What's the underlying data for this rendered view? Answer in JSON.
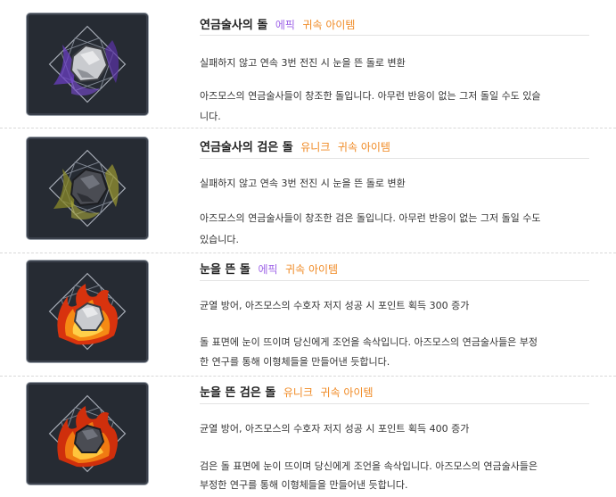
{
  "items": [
    {
      "name": "연금술사의 돌",
      "grade": "에픽",
      "grade_color": "#a066e8",
      "binding": "귀속 아이템",
      "binding_color": "#f08a24",
      "effect": "실패하지 않고 연속 3번 전진 시 눈을 뜬 돌로 변환",
      "desc_line1": "아즈모스의 연금술사들이 창조한 돌입니다. 아무런 반응이 없는 그저 돌일 수도 있슬",
      "desc_line2": "니다.",
      "icon": "grey-alchemist-stone-icon"
    },
    {
      "name": "연금술사의 검은 돌",
      "grade": "유니크",
      "grade_color": "#f08a24",
      "binding": "귀속 아이템",
      "binding_color": "#f08a24",
      "effect": "실패하지 않고 연속 3번 전진 시 눈을 뜬 돌로 변환",
      "desc_line1": "아즈모스의 연금술사들이 창조한 검은 돌입니다. 아무런 반응이 없는 그저 돌일 수도",
      "desc_line2": "있습니다.",
      "icon": "black-alchemist-stone-icon"
    },
    {
      "name": "눈을 뜬 돌",
      "grade": "에픽",
      "grade_color": "#a066e8",
      "binding": "귀속 아이템",
      "binding_color": "#f08a24",
      "effect": "균열 방어, 아즈모스의 수호자 저지 성공 시 포인트 획득 300 증가",
      "desc_line1": "돌 표면에 눈이 뜨이며 당신에게 조언을 속삭입니다. 아즈모스의 연금술사들은 부정",
      "desc_line2": "한 연구를 통해 이형체들을 만들어낸 듯합니다.",
      "icon": "awakened-grey-stone-icon"
    },
    {
      "name": "눈을 뜬 검은 돌",
      "grade": "유니크",
      "grade_color": "#f08a24",
      "binding": "귀속 아이템",
      "binding_color": "#f08a24",
      "effect": "균열 방어, 아즈모스의 수호자 저지 성공 시 포인트 획득 400 증가",
      "desc_line1": "검은 돌 표면에 눈이 뜨이며 당신에게 조언을 속삭입니다. 아즈모스의 연금술사들은",
      "desc_line2": "부정한 연구를 통해 이형체들을 만들어낸 듯합니다.",
      "icon": "awakened-black-stone-icon"
    }
  ]
}
